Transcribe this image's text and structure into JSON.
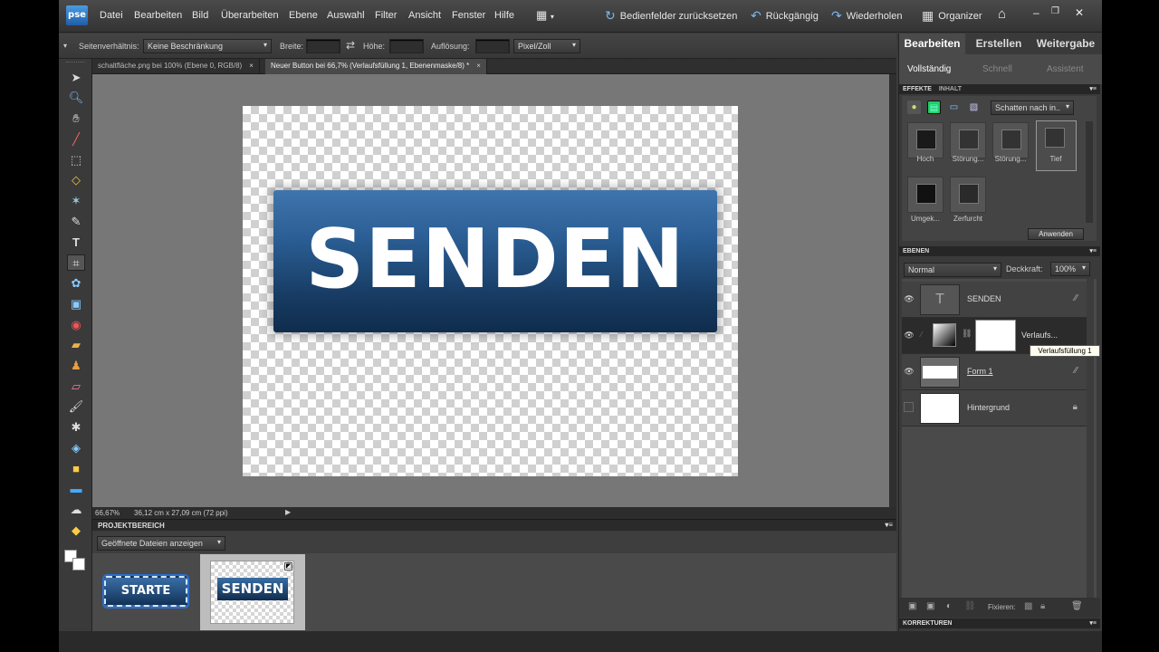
{
  "app": {
    "logo": "pse"
  },
  "menu": [
    "Datei",
    "Bearbeiten",
    "Bild",
    "Überarbeiten",
    "Ebene",
    "Auswahl",
    "Filter",
    "Ansicht",
    "Fenster",
    "Hilfe"
  ],
  "toolbar": {
    "reset_panels": "Bedienfelder zurücksetzen",
    "undo": "Rückgängig",
    "redo": "Wiederholen",
    "organizer": "Organizer"
  },
  "options": {
    "ratio_label": "Seitenverhältnis:",
    "ratio_value": "Keine Beschränkung",
    "width_label": "Breite:",
    "height_label": "Höhe:",
    "resolution_label": "Auflösung:",
    "unit_value": "Pixel/Zoll"
  },
  "tabs": [
    {
      "label": "schaltfläche.png bei 100% (Ebene 0, RGB/8)",
      "close": "×"
    },
    {
      "label": "Neuer Button bei 66,7% (Verlaufsfüllung 1, Ebenenmaske/8) *",
      "close": "×"
    }
  ],
  "canvas": {
    "button_text": "SENDEN"
  },
  "status": {
    "zoom": "66,67%",
    "size": "36,12 cm x 27,09 cm (72 ppi)"
  },
  "project_bin": {
    "title": "PROJEKTBEREICH",
    "dropdown": "Geöffnete Dateien anzeigen",
    "thumb1_text": "STARTE",
    "thumb2_text": "SENDEN"
  },
  "right_panel": {
    "modes": [
      "Bearbeiten",
      "Erstellen",
      "Weitergabe"
    ],
    "submodes": [
      "Vollständig",
      "Schnell",
      "Assistent"
    ],
    "effects_tab": "EFFEKTE",
    "content_tab": "INHALT",
    "effects_dropdown": "Schatten nach in..",
    "effects": [
      "Hoch",
      "Störung...",
      "Störung...",
      "Tief",
      "Umgek...",
      "Zerfurcht"
    ],
    "apply": "Anwenden",
    "layers_title": "EBENEN",
    "blend_mode": "Normal",
    "opacity_label": "Deckkraft:",
    "opacity_value": "100%",
    "layers": [
      {
        "name": "SENDEN",
        "thumb": "T"
      },
      {
        "name": "Verlaufs..."
      },
      {
        "name": "Form 1"
      },
      {
        "name": "Hintergrund"
      }
    ],
    "tooltip": "Verlaufsfüllung 1",
    "fix_label": "Fixieren:",
    "corrections": "KORREKTUREN"
  }
}
